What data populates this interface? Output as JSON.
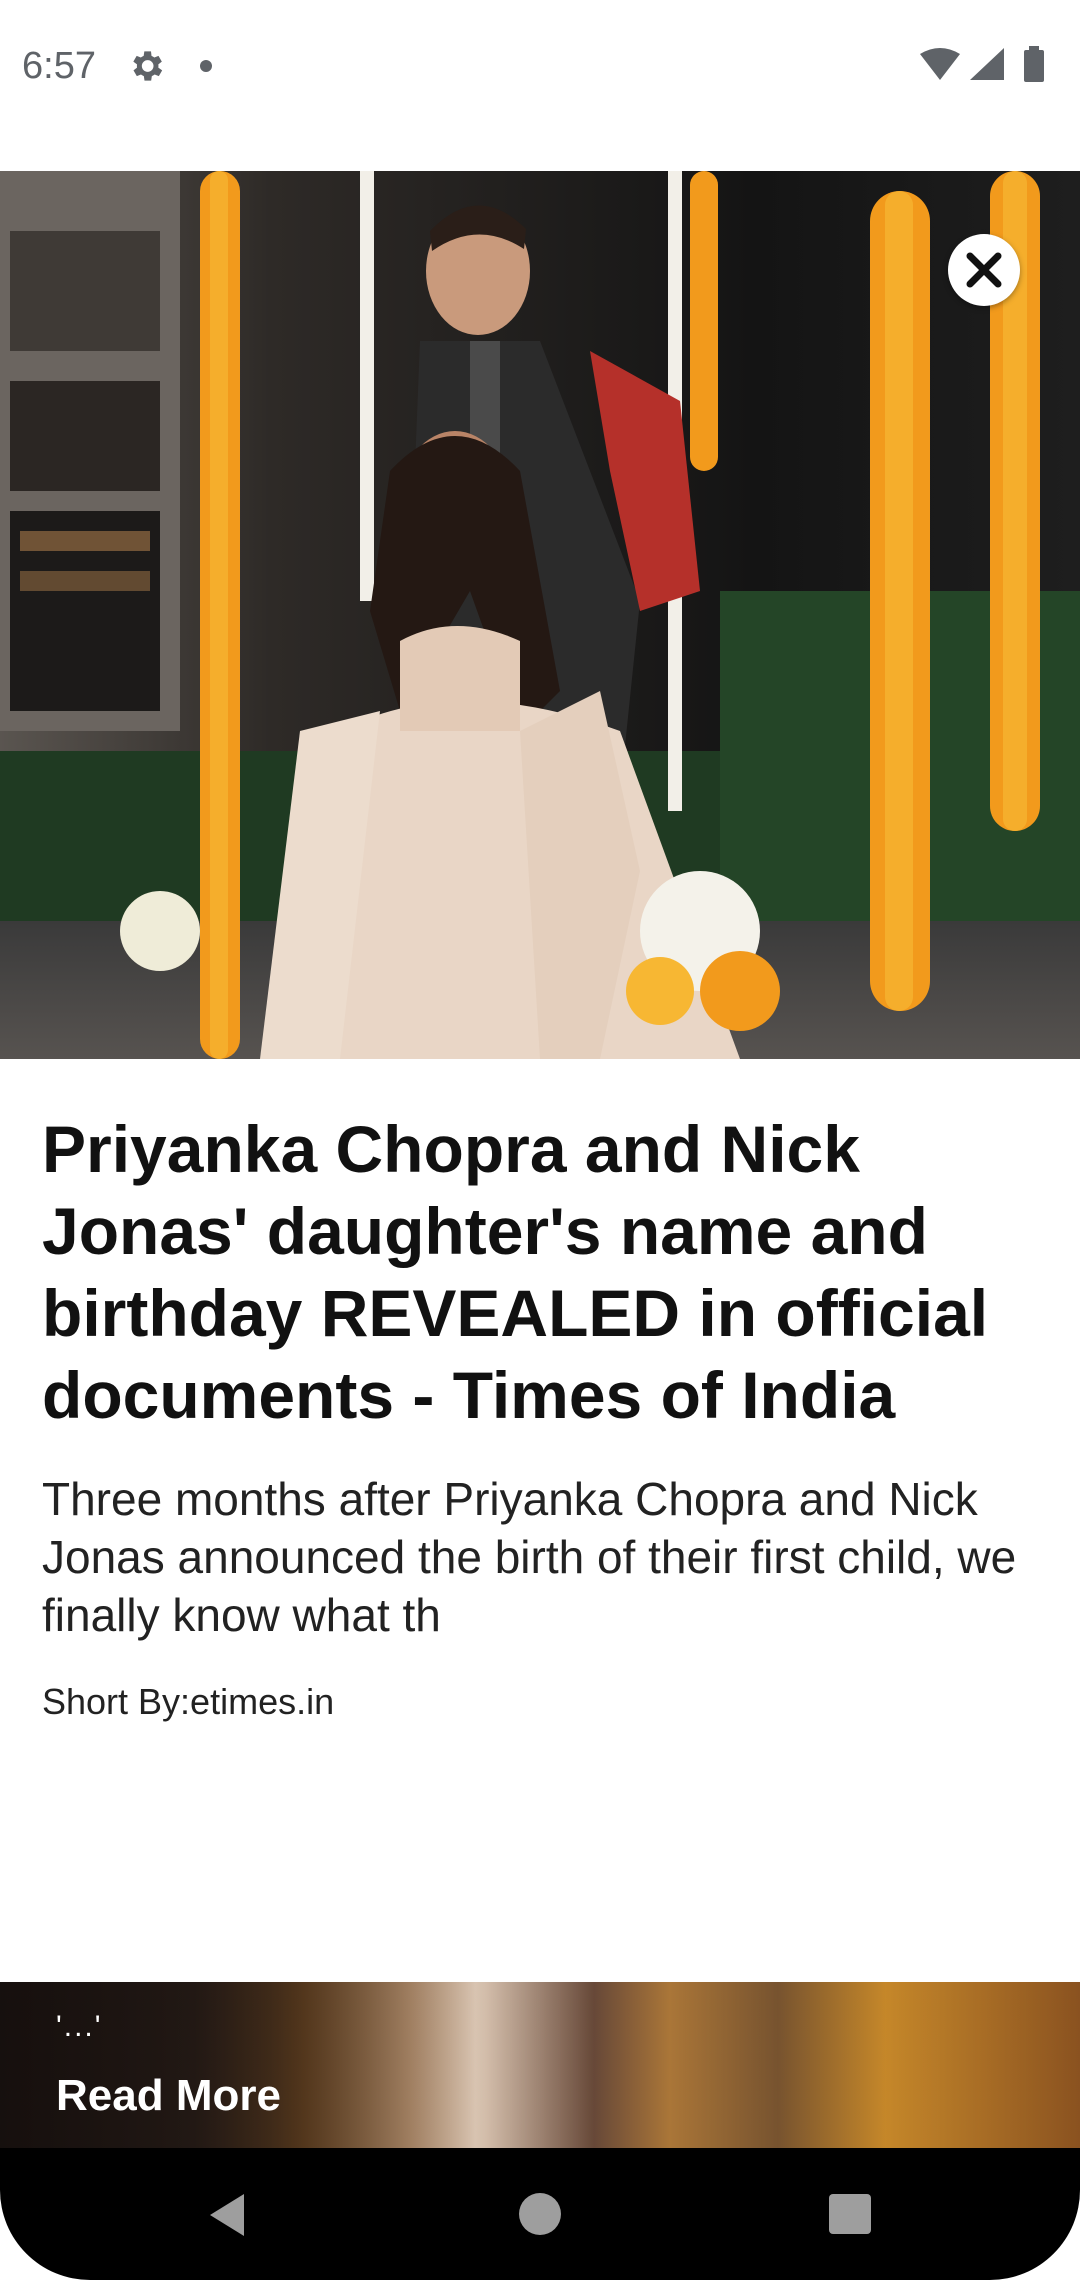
{
  "status_bar": {
    "time": "6:57",
    "icons": [
      "settings-gear-icon",
      "notification-dot-icon",
      "wifi-icon",
      "cell-signal-icon",
      "battery-icon"
    ]
  },
  "article": {
    "close_icon": "close-icon",
    "headline": "Priyanka Chopra and Nick Jonas' daughter's name and birthday REVEALED in official documents - Times of India",
    "summary": "Three months after Priyanka Chopra and Nick Jonas announced the birth of their first child, we finally know what th",
    "byline": "Short By:etimes.in"
  },
  "read_more": {
    "dots": "'...'",
    "label": "Read More"
  },
  "nav": {
    "icons": [
      "back-icon",
      "home-icon",
      "recents-icon"
    ]
  },
  "colors": {
    "marigold": "#f29a1c",
    "text_dark": "#111111",
    "status_gray": "#5f6368",
    "nav_bg": "#000000"
  }
}
